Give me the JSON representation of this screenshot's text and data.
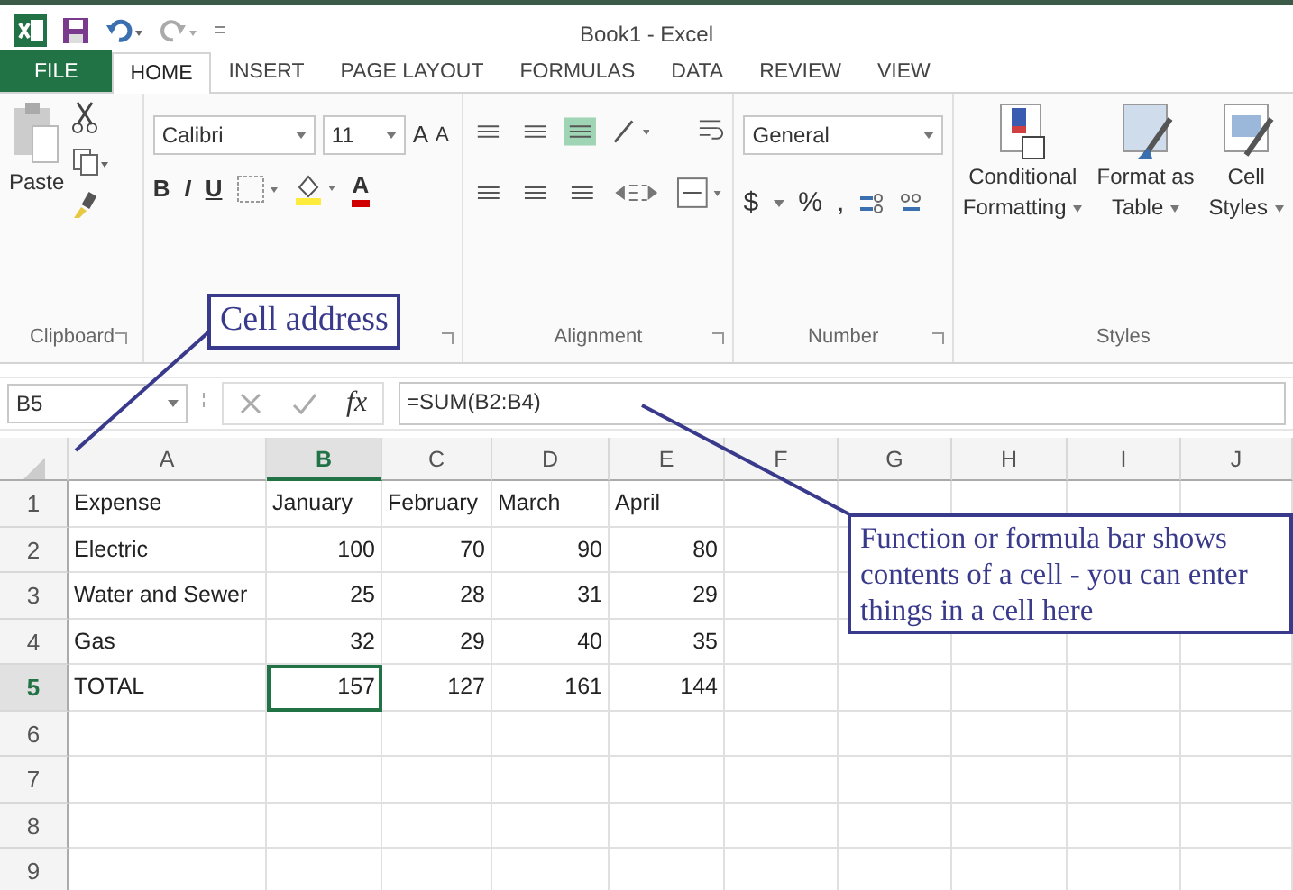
{
  "window": {
    "title": "Book1 - Excel"
  },
  "tabs": [
    {
      "label": "FILE",
      "kind": "file",
      "selected": false
    },
    {
      "label": "HOME",
      "kind": "tab",
      "selected": true
    },
    {
      "label": "INSERT",
      "kind": "tab",
      "selected": false
    },
    {
      "label": "PAGE LAYOUT",
      "kind": "tab",
      "selected": false
    },
    {
      "label": "FORMULAS",
      "kind": "tab",
      "selected": false
    },
    {
      "label": "DATA",
      "kind": "tab",
      "selected": false
    },
    {
      "label": "REVIEW",
      "kind": "tab",
      "selected": false
    },
    {
      "label": "VIEW",
      "kind": "tab",
      "selected": false
    }
  ],
  "ribbon": {
    "clipboard": {
      "paste": "Paste",
      "group": "Clipboard"
    },
    "font": {
      "font_name": "Calibri",
      "font_size": "11",
      "grow": "A",
      "shrink": "A",
      "styles": [
        "B",
        "I",
        "U"
      ],
      "font_color": "A"
    },
    "alignment": {
      "group": "Alignment"
    },
    "number": {
      "format": "General",
      "symbols": [
        "$",
        "%",
        ","
      ],
      "group": "Number"
    },
    "styles": {
      "buttons": [
        {
          "lines": [
            "Conditional",
            "Formatting"
          ]
        },
        {
          "lines": [
            "Format as",
            "Table"
          ]
        },
        {
          "lines": [
            "Cell",
            "Styles"
          ]
        }
      ],
      "group": "Styles"
    }
  },
  "formula_bar": {
    "name_box": "B5",
    "fx": "fx",
    "formula": "=SUM(B2:B4)"
  },
  "sheet": {
    "columns": [
      {
        "label": "A",
        "selected": false
      },
      {
        "label": "B",
        "selected": true
      },
      {
        "label": "C",
        "selected": false
      },
      {
        "label": "D",
        "selected": false
      },
      {
        "label": "E",
        "selected": false
      },
      {
        "label": "F",
        "selected": false
      },
      {
        "label": "G",
        "selected": false
      },
      {
        "label": "H",
        "selected": false
      },
      {
        "label": "I",
        "selected": false
      },
      {
        "label": "J",
        "selected": false
      }
    ],
    "rows": [
      {
        "number": "1",
        "selected": false,
        "cells": [
          "Expense",
          "January",
          "February",
          "March",
          "April"
        ]
      },
      {
        "number": "2",
        "selected": false,
        "cells": [
          "Electric",
          "100",
          "70",
          "90",
          "80"
        ]
      },
      {
        "number": "3",
        "selected": false,
        "cells": [
          "Water and Sewer",
          "25",
          "28",
          "31",
          "29"
        ]
      },
      {
        "number": "4",
        "selected": false,
        "cells": [
          "Gas",
          "32",
          "29",
          "40",
          "35"
        ]
      },
      {
        "number": "5",
        "selected": true,
        "cells": [
          "TOTAL",
          "157",
          "127",
          "161",
          "144"
        ]
      },
      {
        "number": "6",
        "selected": false,
        "cells": []
      },
      {
        "number": "7",
        "selected": false,
        "cells": []
      },
      {
        "number": "8",
        "selected": false,
        "cells": []
      },
      {
        "number": "9",
        "selected": false,
        "cells": []
      }
    ]
  },
  "callouts": [
    {
      "text": "Cell address"
    },
    {
      "text": "Function or formula bar shows contents of a cell - you can enter things in a cell here"
    }
  ]
}
